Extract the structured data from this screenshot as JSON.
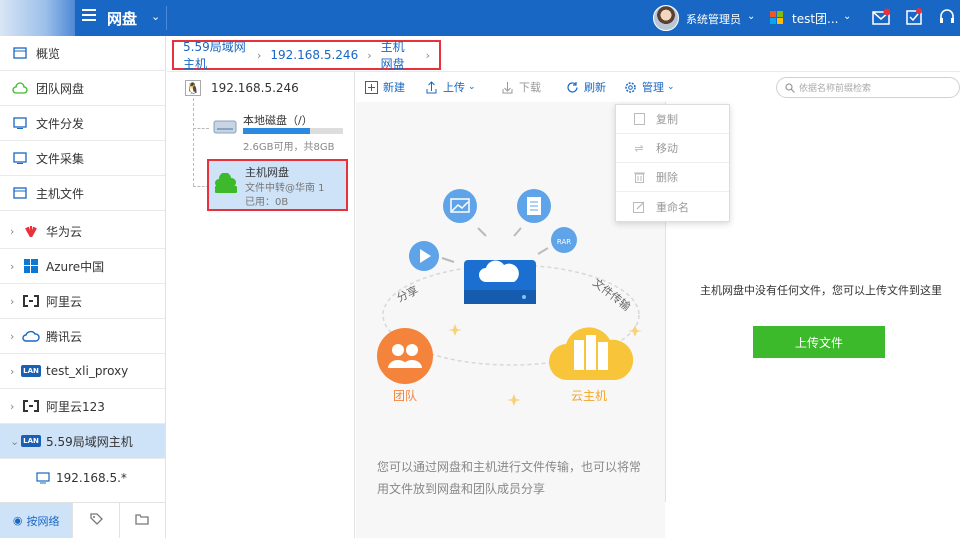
{
  "header": {
    "app_title": "网盘",
    "user_name": "系统管理员",
    "org_name": "test团..."
  },
  "sidebar": {
    "items": [
      {
        "label": "概览",
        "icon": "overview-icon"
      },
      {
        "label": "团队网盘",
        "icon": "cloud-icon"
      },
      {
        "label": "文件分发",
        "icon": "distribute-icon"
      },
      {
        "label": "文件采集",
        "icon": "collect-icon"
      },
      {
        "label": "主机文件",
        "icon": "host-file-icon"
      },
      {
        "label": "华为云",
        "icon": "huawei-icon"
      },
      {
        "label": "Azure中国",
        "icon": "azure-icon"
      },
      {
        "label": "阿里云",
        "icon": "aliyun-icon"
      },
      {
        "label": "腾讯云",
        "icon": "tencent-icon"
      },
      {
        "label": "test_xli_proxy",
        "icon": "lan-icon"
      },
      {
        "label": "阿里云123",
        "icon": "aliyun-icon"
      },
      {
        "label": "5.59局域网主机",
        "icon": "lan-icon"
      }
    ],
    "sub_item": "192.168.5.*",
    "tabs": {
      "network": "按网络"
    }
  },
  "breadcrumb": [
    "5.59局域网主机",
    "192.168.5.246",
    "主机网盘"
  ],
  "tree": {
    "root": "192.168.5.246",
    "local_disk": {
      "title": "本地磁盘（/）",
      "info": "2.6GB可用，共8GB",
      "used_fraction": 0.67
    },
    "host_disk": {
      "title": "主机网盘",
      "sub": "文件中转@华南 1",
      "used": "已用：0B"
    }
  },
  "toolbar": {
    "new": "新建",
    "upload": "上传",
    "download": "下载",
    "refresh": "刷新",
    "manage": "管理",
    "search_placeholder": "依据名称前缀检索"
  },
  "menu": [
    "复制",
    "移动",
    "删除",
    "重命名"
  ],
  "illustration": {
    "share": "分享",
    "transfer": "文件传输",
    "team": "团队",
    "cloud_host": "云主机"
  },
  "empty": {
    "message": "主机网盘中没有任何文件，您可以上传文件到这里",
    "upload_button": "上传文件",
    "description": "您可以通过网盘和主机进行文件传输，也可以将常用文件放到网盘和团队成员分享"
  }
}
